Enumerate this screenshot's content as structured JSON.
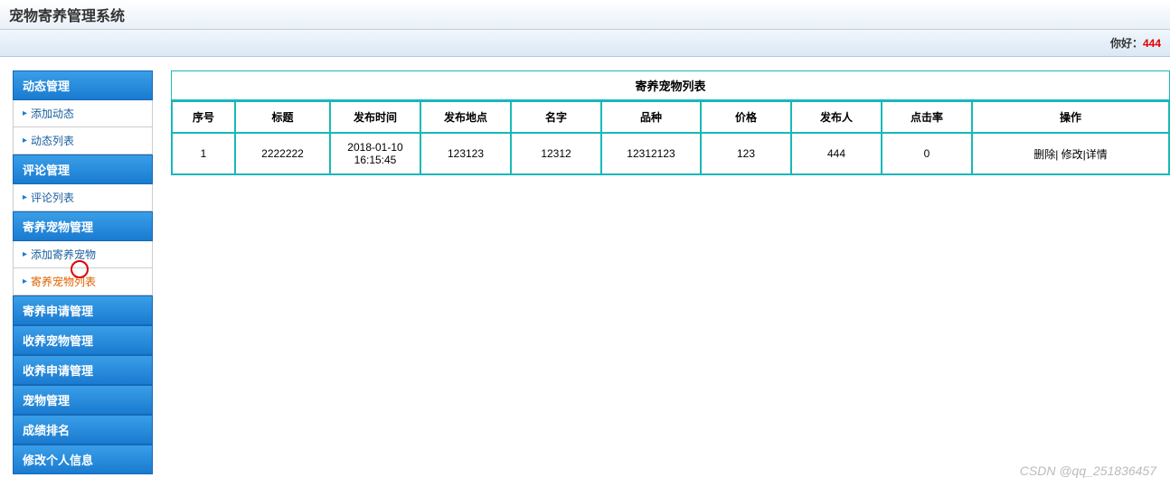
{
  "header": {
    "title": "宠物寄养管理系统"
  },
  "topbar": {
    "greeting": "你好：",
    "username": "444"
  },
  "sidebar": {
    "sections": [
      {
        "header": "动态管理",
        "items": [
          {
            "label": "添加动态",
            "active": false
          },
          {
            "label": "动态列表",
            "active": false
          }
        ]
      },
      {
        "header": "评论管理",
        "items": [
          {
            "label": "评论列表",
            "active": false
          }
        ]
      },
      {
        "header": "寄养宠物管理",
        "items": [
          {
            "label": "添加寄养宠物",
            "active": false
          },
          {
            "label": "寄养宠物列表",
            "active": true
          }
        ]
      },
      {
        "header": "寄养申请管理",
        "items": []
      },
      {
        "header": "收养宠物管理",
        "items": []
      },
      {
        "header": "收养申请管理",
        "items": []
      },
      {
        "header": "宠物管理",
        "items": []
      },
      {
        "header": "成绩排名",
        "items": []
      },
      {
        "header": "修改个人信息",
        "items": []
      }
    ]
  },
  "main": {
    "table_title": "寄养宠物列表",
    "columns": [
      "序号",
      "标题",
      "发布时间",
      "发布地点",
      "名字",
      "品种",
      "价格",
      "发布人",
      "点击率",
      "操作"
    ],
    "rows": [
      {
        "seq": "1",
        "title": "2222222",
        "pubtime": "2018-01-10 16:15:45",
        "location": "123123",
        "name": "12312",
        "breed": "12312123",
        "price": "123",
        "publisher": "444",
        "clicks": "0",
        "actions": "删除| 修改|详情"
      }
    ]
  },
  "watermark": "CSDN @qq_251836457"
}
